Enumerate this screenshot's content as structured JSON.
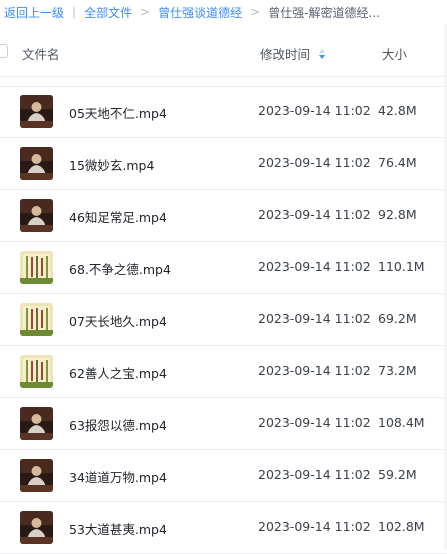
{
  "breadcrumb": {
    "back": "返回上一级",
    "root": "全部文件",
    "folder": "曾仕强谈道德经",
    "current": "曾仕强-解密道德经..."
  },
  "table": {
    "headers": {
      "name": "文件名",
      "time": "修改时间",
      "size": "大小"
    },
    "sort": {
      "column": "time",
      "direction": "desc"
    },
    "rows": [
      {
        "name": "05天地不仁.mp4",
        "time": "2023-09-14 11:02",
        "size": "42.8M",
        "thumb": "video-portrait"
      },
      {
        "name": "15微妙玄.mp4",
        "time": "2023-09-14 11:02",
        "size": "76.4M",
        "thumb": "video-portrait"
      },
      {
        "name": "46知足常足.mp4",
        "time": "2023-09-14 11:02",
        "size": "92.8M",
        "thumb": "video-portrait"
      },
      {
        "name": "68.不争之德.mp4",
        "time": "2023-09-14 11:02",
        "size": "110.1M",
        "thumb": "video-scroll"
      },
      {
        "name": "07天长地久.mp4",
        "time": "2023-09-14 11:02",
        "size": "69.2M",
        "thumb": "video-scroll"
      },
      {
        "name": "62善人之宝.mp4",
        "time": "2023-09-14 11:02",
        "size": "73.2M",
        "thumb": "video-scroll"
      },
      {
        "name": "63报怨以德.mp4",
        "time": "2023-09-14 11:02",
        "size": "108.4M",
        "thumb": "video-portrait"
      },
      {
        "name": "34道道万物.mp4",
        "time": "2023-09-14 11:02",
        "size": "59.2M",
        "thumb": "video-portrait"
      },
      {
        "name": "53大道甚夷.mp4",
        "time": "2023-09-14 11:02",
        "size": "102.8M",
        "thumb": "video-portrait"
      }
    ]
  },
  "colors": {
    "accent": "#3b8cff",
    "text": "#1f2329",
    "muted": "#4e5561",
    "divider": "#eceef2"
  }
}
